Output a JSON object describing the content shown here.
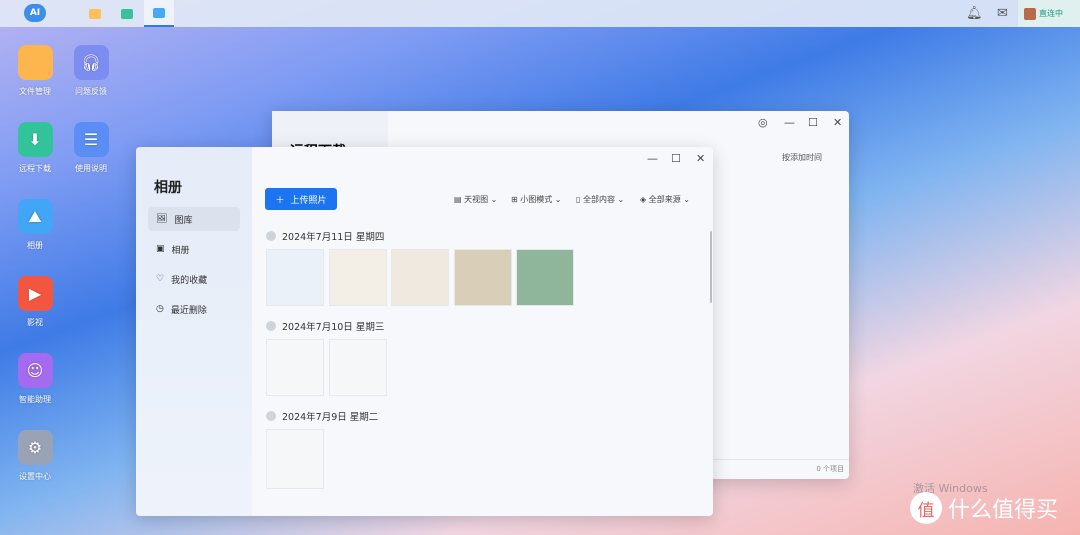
{
  "taskbar": {
    "logo": "AI",
    "status": "直连中"
  },
  "desktop": [
    {
      "label": "文件管理",
      "color": "#fdb54e"
    },
    {
      "label": "问题反馈",
      "color": "#7d8cf0"
    },
    {
      "label": "远程下载",
      "color": "#33c39a"
    },
    {
      "label": "使用说明",
      "color": "#5a8df5"
    },
    {
      "label": "相册",
      "color": "#42a5f5"
    },
    {
      "label": "影视",
      "color": "#f2563f"
    },
    {
      "label": "智能助理",
      "color": "#a46af0"
    },
    {
      "label": "设置中心",
      "color": "#9aa3b5"
    }
  ],
  "back_window": {
    "title": "远程下载",
    "sort": "按添加时间",
    "count": "0 个项目"
  },
  "album": {
    "title": "相册",
    "nav": [
      "图库",
      "相册",
      "我的收藏",
      "最近删除"
    ],
    "upload": "上传照片",
    "filters": [
      "天视图",
      "小图模式",
      "全部内容",
      "全部来源"
    ],
    "groups": [
      {
        "date": "2024年7月11日 星期四",
        "count": 5
      },
      {
        "date": "2024年7月10日 星期三",
        "count": 2
      },
      {
        "date": "2024年7月9日 星期二",
        "count": 1
      }
    ]
  },
  "watermark": {
    "activate": "激活 Windows",
    "brand": "什么值得买"
  }
}
